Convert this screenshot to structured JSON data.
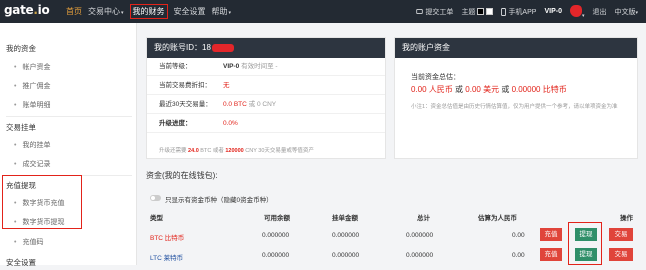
{
  "topbar": {
    "logo_main": "gate",
    "logo_dot": ".",
    "logo_tld": "io",
    "nav": [
      {
        "label": "首页"
      },
      {
        "label": "交易中心"
      },
      {
        "label": "我的财务"
      },
      {
        "label": "安全设置"
      },
      {
        "label": "帮助"
      }
    ],
    "caret": "▾",
    "ticket": "提交工单",
    "theme": "主题",
    "app": "手机APP",
    "vip": "VIP-0",
    "logout": "退出",
    "lang": "中文版"
  },
  "sidebar": {
    "sections": [
      {
        "title": "我的资金",
        "items": [
          "帐户资金",
          "推广佣金",
          "账单明细"
        ]
      },
      {
        "title": "交易挂单",
        "items": [
          "我的挂单",
          "成交记录"
        ]
      },
      {
        "title": "充值提现",
        "items": [
          "数字货币充值",
          "数字货币提现",
          "充值码"
        ]
      },
      {
        "title": "安全设置",
        "items": []
      }
    ]
  },
  "account": {
    "header_label": "我的账号ID：",
    "header_id": "18",
    "level_label": "当前等级：",
    "level_value": "VIP-0",
    "level_note": "有效时间至 -",
    "discount_label": "当前交易费折扣：",
    "discount_value": "无",
    "volume_label": "最近30天交易量：",
    "volume_btc": "0.0 BTC",
    "volume_or": "或",
    "volume_cny": "0 CNY",
    "progress_label": "升级进度：",
    "progress_value": "0.0%",
    "footer_pre": "升级还需要",
    "footer_btc": "24.0",
    "footer_mid": "BTC 或者",
    "footer_cny": "120000",
    "footer_post": "CNY 30天交易量或等值资产"
  },
  "assets": {
    "header": "我的账户资金",
    "total_label": "当前资金总估：",
    "cny_val": "0.00",
    "cny_unit": "人民币",
    "or1": "或",
    "usd_val": "0.00",
    "usd_unit": "美元",
    "or2": "或",
    "btc_val": "0.00000",
    "btc_unit": "比特币",
    "tip": "小注1：资金总估值是由历史行情估算值，仅为用户提供一个参考，请以单项资金为准"
  },
  "funds": {
    "title": "资金(我的在线钱包):",
    "toggle_label": "只显示有资金币种（隐藏0资金币种）",
    "columns": [
      "类型",
      "可用余额",
      "挂单金额",
      "总计",
      "估算为人民币",
      "操作"
    ],
    "rows": [
      {
        "coin": "BTC 比特币",
        "available": "0.000000",
        "order": "0.000000",
        "total": "0.000000",
        "cny": "0.00",
        "deposit": "充值",
        "withdraw": "提现",
        "trade": "交易"
      },
      {
        "coin": "LTC 莱特币",
        "available": "0.000000",
        "order": "0.000000",
        "total": "0.000000",
        "cny": "0.00",
        "deposit": "充值",
        "withdraw": "提现",
        "trade": "交易"
      }
    ]
  },
  "colors": {
    "accent_red": "#e2231a",
    "header_dark": "#2d3540",
    "btn_red": "#e0443a",
    "btn_green": "#2f8f69"
  }
}
